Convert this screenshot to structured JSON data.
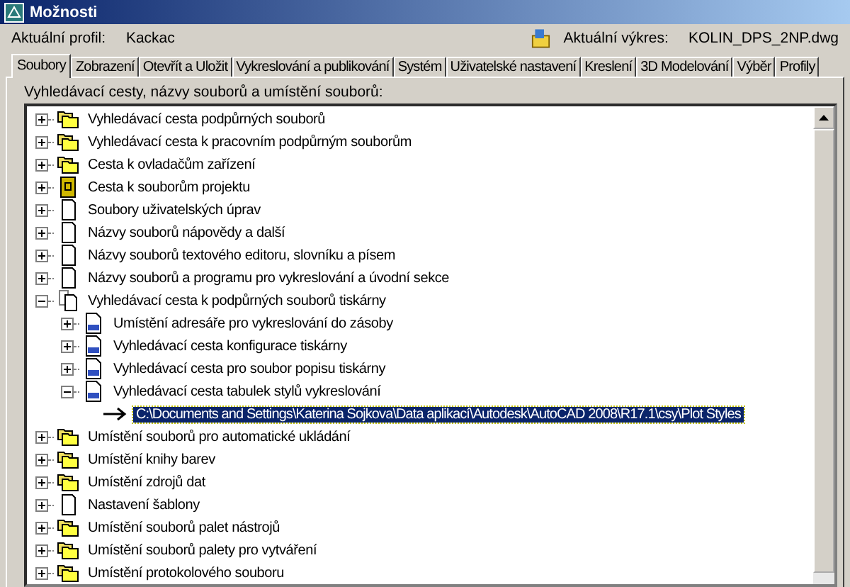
{
  "window": {
    "title": "Možnosti"
  },
  "profile": {
    "label": "Aktuální profil:",
    "value": "Kackac"
  },
  "drawing": {
    "label": "Aktuální výkres:",
    "value": "KOLIN_DPS_2NP.dwg"
  },
  "tabs": [
    {
      "label": "Soubory",
      "selected": true
    },
    {
      "label": "Zobrazení",
      "selected": false
    },
    {
      "label": "Otevřít a Uložit",
      "selected": false
    },
    {
      "label": "Vykreslování a publikování",
      "selected": false
    },
    {
      "label": "Systém",
      "selected": false
    },
    {
      "label": "Uživatelské nastavení",
      "selected": false
    },
    {
      "label": "Kreslení",
      "selected": false
    },
    {
      "label": "3D Modelování",
      "selected": false
    },
    {
      "label": "Výběr",
      "selected": false
    },
    {
      "label": "Profily",
      "selected": false
    }
  ],
  "tree_label": "Vyhledávací cesty, názvy souborů a umístění souborů:",
  "tree": [
    {
      "kind": "folders",
      "label": "Vyhledávací cesta podpůrných souborů",
      "expanded": false,
      "selected": false
    },
    {
      "kind": "folders",
      "label": "Vyhledávací cesta k pracovním podpůrným souborům",
      "expanded": false,
      "selected": false
    },
    {
      "kind": "folders",
      "label": "Cesta k ovladačům zařízení",
      "expanded": false,
      "selected": false
    },
    {
      "kind": "project",
      "label": "Cesta k souborům projektu",
      "expanded": false,
      "selected": false
    },
    {
      "kind": "page",
      "label": "Soubory uživatelských úprav",
      "expanded": false,
      "selected": false
    },
    {
      "kind": "page",
      "label": "Názvy souborů nápovědy a další",
      "expanded": false,
      "selected": false
    },
    {
      "kind": "page",
      "label": "Názvy souborů textového editoru, slovníku a písem",
      "expanded": false,
      "selected": false
    },
    {
      "kind": "page",
      "label": "Názvy souborů a programu pro vykreslování a úvodní sekce",
      "expanded": false,
      "selected": false
    },
    {
      "kind": "printer",
      "label": "Vyhledávací cesta k podpůrných souborů tiskárny",
      "expanded": true,
      "selected": false,
      "children": [
        {
          "kind": "pst",
          "label": "Umístění adresáře pro vykreslování do zásoby",
          "expanded": false,
          "selected": false
        },
        {
          "kind": "pst",
          "label": "Vyhledávací cesta konfigurace tiskárny",
          "expanded": false,
          "selected": false
        },
        {
          "kind": "pst",
          "label": "Vyhledávací cesta pro soubor popisu tiskárny",
          "expanded": false,
          "selected": false
        },
        {
          "kind": "pst",
          "label": "Vyhledávací cesta tabulek stylů vykreslování",
          "expanded": true,
          "selected": false,
          "children": [
            {
              "kind": "path",
              "label": "C:\\Documents and Settings\\Katerina Sojkova\\Data aplikací\\Autodesk\\AutoCAD 2008\\R17.1\\csy\\Plot Styles",
              "selected": true
            }
          ]
        }
      ]
    },
    {
      "kind": "folders",
      "label": "Umístění souborů pro automatické ukládání",
      "expanded": false,
      "selected": false
    },
    {
      "kind": "folders",
      "label": "Umístění knihy barev",
      "expanded": false,
      "selected": false
    },
    {
      "kind": "folders",
      "label": "Umístění zdrojů dat",
      "expanded": false,
      "selected": false
    },
    {
      "kind": "page",
      "label": "Nastavení šablony",
      "expanded": false,
      "selected": false
    },
    {
      "kind": "folders",
      "label": "Umístění souborů palet nástrojů",
      "expanded": false,
      "selected": false
    },
    {
      "kind": "folders",
      "label": "Umístění souborů palety pro vytváření",
      "expanded": false,
      "selected": false
    },
    {
      "kind": "folders",
      "label": "Umístění protokolového souboru",
      "expanded": false,
      "selected": false
    }
  ]
}
